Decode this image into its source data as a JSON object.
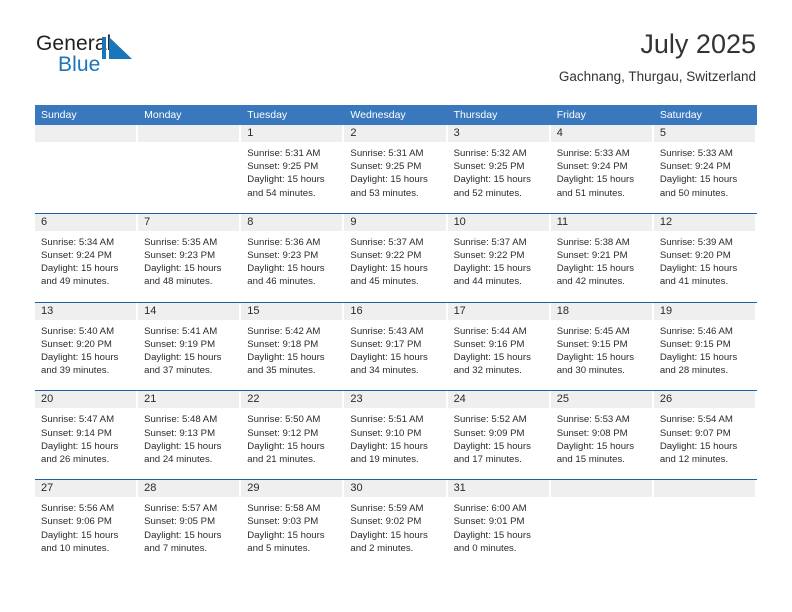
{
  "brand": {
    "name_part1": "General",
    "name_part2": "Blue",
    "mark": "triangle-logo-icon",
    "color_dark": "#231f20",
    "color_blue": "#1a75bb"
  },
  "header": {
    "title": "July 2025",
    "subtitle": "Gachnang, Thurgau, Switzerland"
  },
  "theme": {
    "header_blue": "#3a78bd",
    "rule_blue": "#1f5fa8",
    "daynum_band": "#efefef",
    "text": "#2b2b2b"
  },
  "calendar": {
    "weekdays": [
      "Sunday",
      "Monday",
      "Tuesday",
      "Wednesday",
      "Thursday",
      "Friday",
      "Saturday"
    ],
    "labels": {
      "sunrise": "Sunrise:",
      "sunset": "Sunset:",
      "daylight": "Daylight:"
    },
    "weeks": [
      [
        {
          "day": "",
          "lines": [
            "",
            "",
            "",
            ""
          ]
        },
        {
          "day": "",
          "lines": [
            "",
            "",
            "",
            ""
          ]
        },
        {
          "day": "1",
          "lines": [
            "Sunrise: 5:31 AM",
            "Sunset: 9:25 PM",
            "Daylight: 15 hours",
            "and 54 minutes."
          ]
        },
        {
          "day": "2",
          "lines": [
            "Sunrise: 5:31 AM",
            "Sunset: 9:25 PM",
            "Daylight: 15 hours",
            "and 53 minutes."
          ]
        },
        {
          "day": "3",
          "lines": [
            "Sunrise: 5:32 AM",
            "Sunset: 9:25 PM",
            "Daylight: 15 hours",
            "and 52 minutes."
          ]
        },
        {
          "day": "4",
          "lines": [
            "Sunrise: 5:33 AM",
            "Sunset: 9:24 PM",
            "Daylight: 15 hours",
            "and 51 minutes."
          ]
        },
        {
          "day": "5",
          "lines": [
            "Sunrise: 5:33 AM",
            "Sunset: 9:24 PM",
            "Daylight: 15 hours",
            "and 50 minutes."
          ]
        }
      ],
      [
        {
          "day": "6",
          "lines": [
            "Sunrise: 5:34 AM",
            "Sunset: 9:24 PM",
            "Daylight: 15 hours",
            "and 49 minutes."
          ]
        },
        {
          "day": "7",
          "lines": [
            "Sunrise: 5:35 AM",
            "Sunset: 9:23 PM",
            "Daylight: 15 hours",
            "and 48 minutes."
          ]
        },
        {
          "day": "8",
          "lines": [
            "Sunrise: 5:36 AM",
            "Sunset: 9:23 PM",
            "Daylight: 15 hours",
            "and 46 minutes."
          ]
        },
        {
          "day": "9",
          "lines": [
            "Sunrise: 5:37 AM",
            "Sunset: 9:22 PM",
            "Daylight: 15 hours",
            "and 45 minutes."
          ]
        },
        {
          "day": "10",
          "lines": [
            "Sunrise: 5:37 AM",
            "Sunset: 9:22 PM",
            "Daylight: 15 hours",
            "and 44 minutes."
          ]
        },
        {
          "day": "11",
          "lines": [
            "Sunrise: 5:38 AM",
            "Sunset: 9:21 PM",
            "Daylight: 15 hours",
            "and 42 minutes."
          ]
        },
        {
          "day": "12",
          "lines": [
            "Sunrise: 5:39 AM",
            "Sunset: 9:20 PM",
            "Daylight: 15 hours",
            "and 41 minutes."
          ]
        }
      ],
      [
        {
          "day": "13",
          "lines": [
            "Sunrise: 5:40 AM",
            "Sunset: 9:20 PM",
            "Daylight: 15 hours",
            "and 39 minutes."
          ]
        },
        {
          "day": "14",
          "lines": [
            "Sunrise: 5:41 AM",
            "Sunset: 9:19 PM",
            "Daylight: 15 hours",
            "and 37 minutes."
          ]
        },
        {
          "day": "15",
          "lines": [
            "Sunrise: 5:42 AM",
            "Sunset: 9:18 PM",
            "Daylight: 15 hours",
            "and 35 minutes."
          ]
        },
        {
          "day": "16",
          "lines": [
            "Sunrise: 5:43 AM",
            "Sunset: 9:17 PM",
            "Daylight: 15 hours",
            "and 34 minutes."
          ]
        },
        {
          "day": "17",
          "lines": [
            "Sunrise: 5:44 AM",
            "Sunset: 9:16 PM",
            "Daylight: 15 hours",
            "and 32 minutes."
          ]
        },
        {
          "day": "18",
          "lines": [
            "Sunrise: 5:45 AM",
            "Sunset: 9:15 PM",
            "Daylight: 15 hours",
            "and 30 minutes."
          ]
        },
        {
          "day": "19",
          "lines": [
            "Sunrise: 5:46 AM",
            "Sunset: 9:15 PM",
            "Daylight: 15 hours",
            "and 28 minutes."
          ]
        }
      ],
      [
        {
          "day": "20",
          "lines": [
            "Sunrise: 5:47 AM",
            "Sunset: 9:14 PM",
            "Daylight: 15 hours",
            "and 26 minutes."
          ]
        },
        {
          "day": "21",
          "lines": [
            "Sunrise: 5:48 AM",
            "Sunset: 9:13 PM",
            "Daylight: 15 hours",
            "and 24 minutes."
          ]
        },
        {
          "day": "22",
          "lines": [
            "Sunrise: 5:50 AM",
            "Sunset: 9:12 PM",
            "Daylight: 15 hours",
            "and 21 minutes."
          ]
        },
        {
          "day": "23",
          "lines": [
            "Sunrise: 5:51 AM",
            "Sunset: 9:10 PM",
            "Daylight: 15 hours",
            "and 19 minutes."
          ]
        },
        {
          "day": "24",
          "lines": [
            "Sunrise: 5:52 AM",
            "Sunset: 9:09 PM",
            "Daylight: 15 hours",
            "and 17 minutes."
          ]
        },
        {
          "day": "25",
          "lines": [
            "Sunrise: 5:53 AM",
            "Sunset: 9:08 PM",
            "Daylight: 15 hours",
            "and 15 minutes."
          ]
        },
        {
          "day": "26",
          "lines": [
            "Sunrise: 5:54 AM",
            "Sunset: 9:07 PM",
            "Daylight: 15 hours",
            "and 12 minutes."
          ]
        }
      ],
      [
        {
          "day": "27",
          "lines": [
            "Sunrise: 5:56 AM",
            "Sunset: 9:06 PM",
            "Daylight: 15 hours",
            "and 10 minutes."
          ]
        },
        {
          "day": "28",
          "lines": [
            "Sunrise: 5:57 AM",
            "Sunset: 9:05 PM",
            "Daylight: 15 hours",
            "and 7 minutes."
          ]
        },
        {
          "day": "29",
          "lines": [
            "Sunrise: 5:58 AM",
            "Sunset: 9:03 PM",
            "Daylight: 15 hours",
            "and 5 minutes."
          ]
        },
        {
          "day": "30",
          "lines": [
            "Sunrise: 5:59 AM",
            "Sunset: 9:02 PM",
            "Daylight: 15 hours",
            "and 2 minutes."
          ]
        },
        {
          "day": "31",
          "lines": [
            "Sunrise: 6:00 AM",
            "Sunset: 9:01 PM",
            "Daylight: 15 hours",
            "and 0 minutes."
          ]
        },
        {
          "day": "",
          "lines": [
            "",
            "",
            "",
            ""
          ]
        },
        {
          "day": "",
          "lines": [
            "",
            "",
            "",
            ""
          ]
        }
      ]
    ]
  }
}
